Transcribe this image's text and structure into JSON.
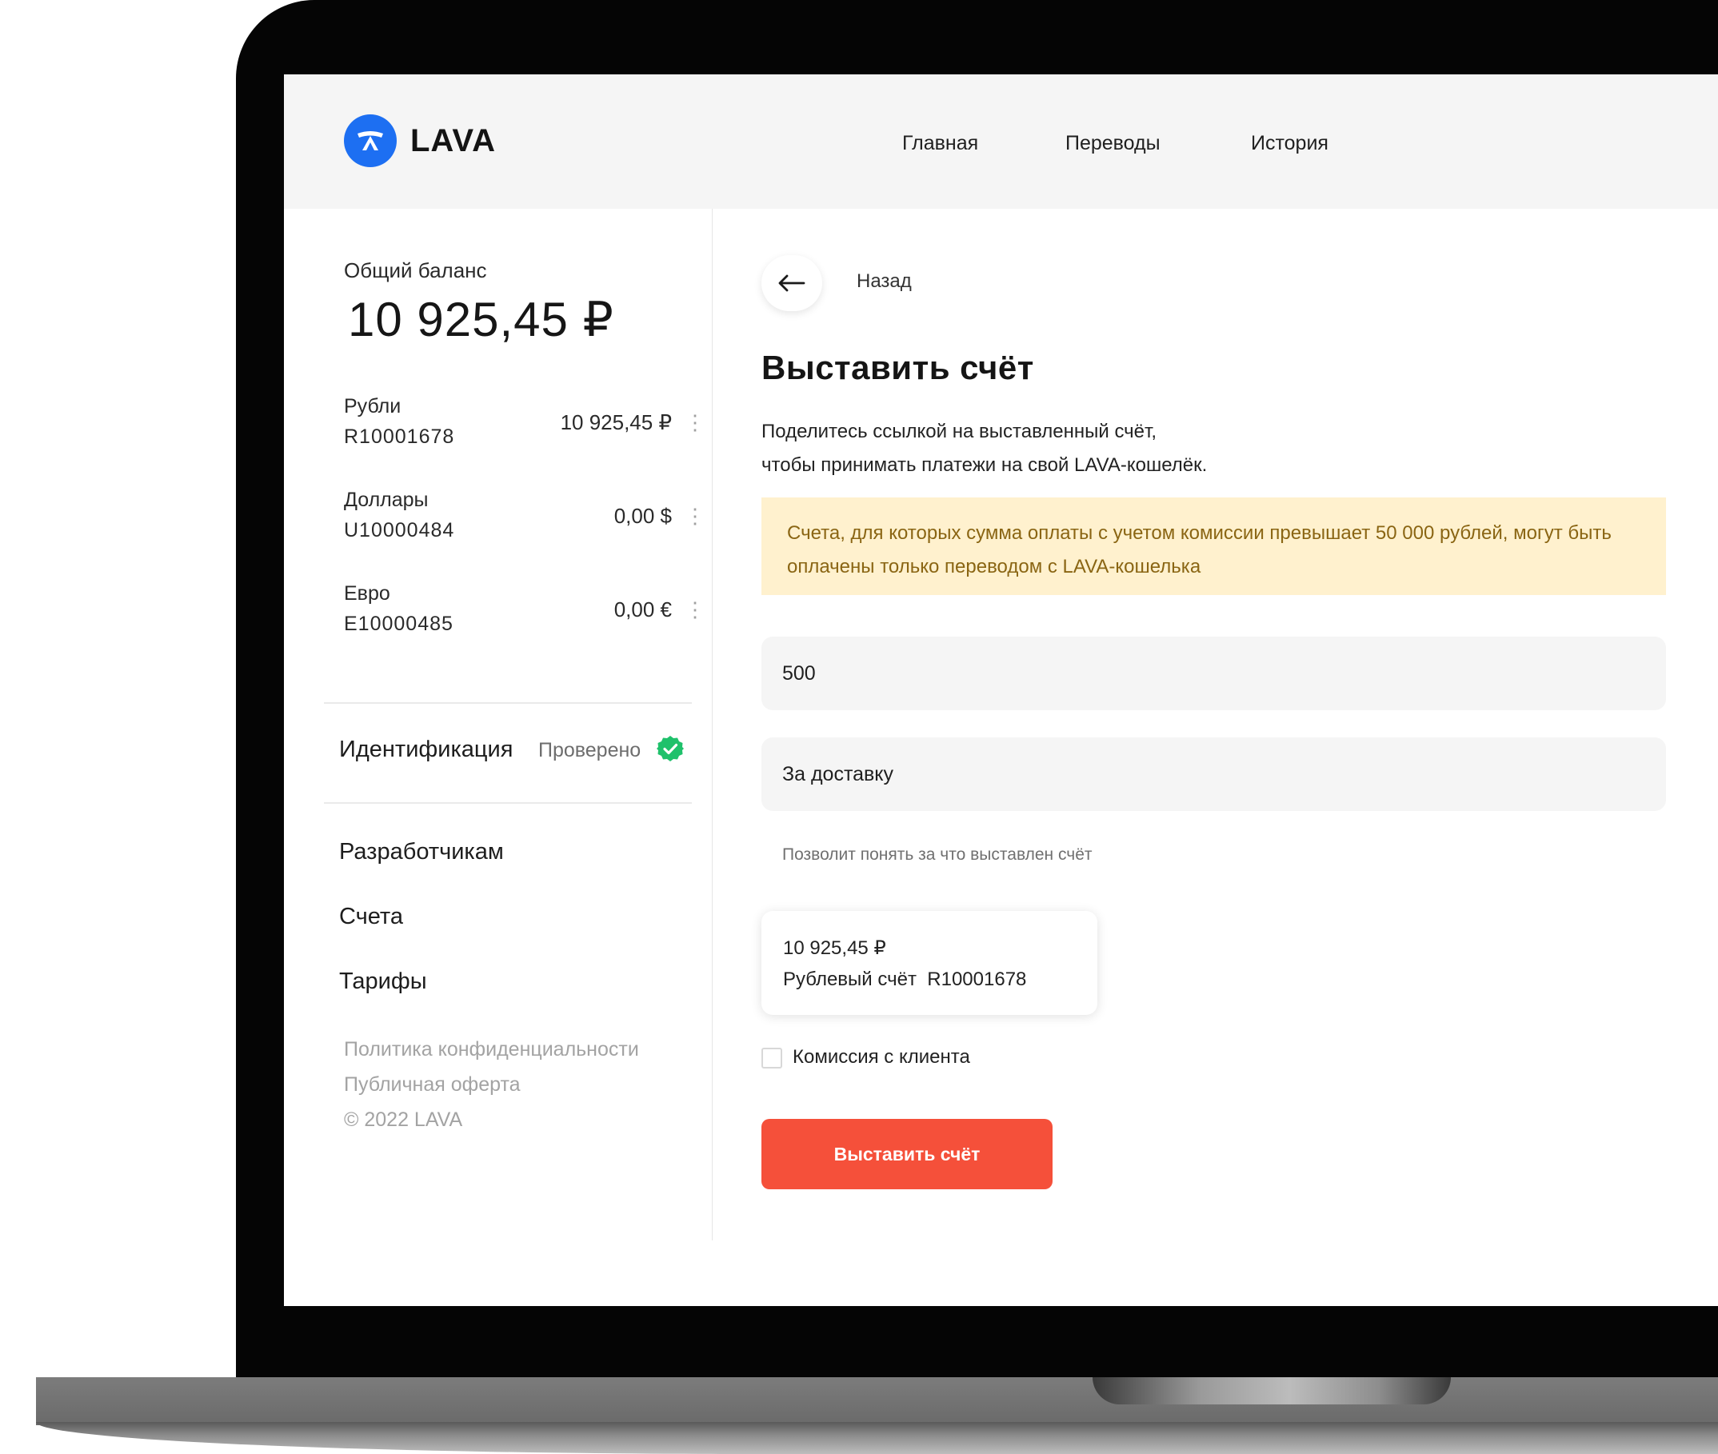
{
  "header": {
    "logo_text": "LAVA",
    "nav": [
      "Главная",
      "Переводы",
      "История"
    ]
  },
  "sidebar": {
    "balance_label": "Общий баланс",
    "balance_total": "10 925,45 ₽",
    "wallets": [
      {
        "name": "Рубли",
        "number": "R10001678",
        "amount": "10 925,45 ₽"
      },
      {
        "name": "Доллары",
        "number": "U10000484",
        "amount": "0,00 $"
      },
      {
        "name": "Евро",
        "number": "E10000485",
        "amount": "0,00 €"
      }
    ],
    "identification_label": "Идентификация",
    "identification_status": "Проверено",
    "links": [
      "Разработчикам",
      "Счета",
      "Тарифы"
    ],
    "footer": [
      "Политика конфиденциальности",
      "Публичная оферта",
      "© 2022 LAVA"
    ]
  },
  "main": {
    "back_label": "Назад",
    "title": "Выставить счёт",
    "description_line1": "Поделитесь ссылкой на выставленный счёт,",
    "description_line2": "чтобы принимать платежи на свой LAVA-кошелёк.",
    "notice": "Счета, для которых сумма оплаты с учетом комиссии превышает 50 000 рублей, могут быть оплачены только переводом с LAVA-кошелька",
    "amount_value": "500",
    "purpose_value": "За доставку",
    "purpose_hint": "Позволит понять за что выставлен счёт",
    "account_card": {
      "amount": "10 925,45 ₽",
      "name": "Рублевый счёт  R10001678"
    },
    "commission_label": "Комиссия с клиента",
    "submit_label": "Выставить счёт"
  },
  "colors": {
    "brand_blue": "#1d6ff2",
    "accent_red": "#f5503a",
    "notice_bg": "#fff1ce",
    "verified_green": "#1fc16b"
  }
}
